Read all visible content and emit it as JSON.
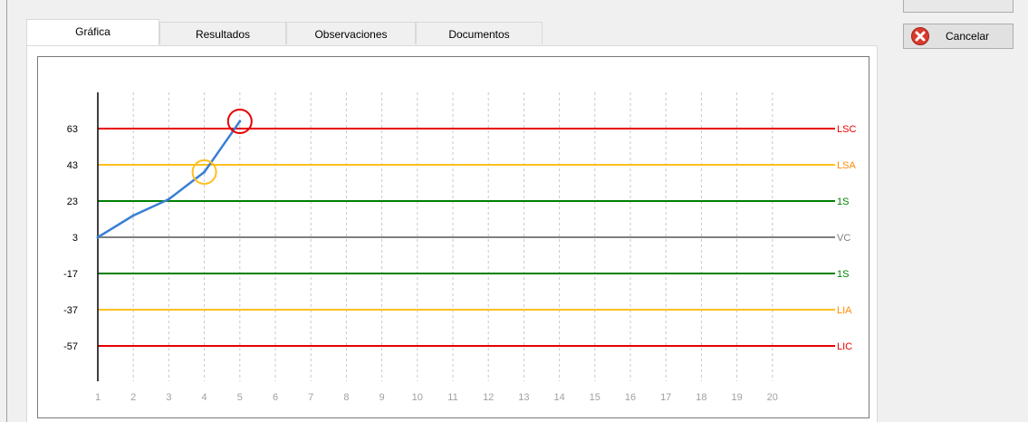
{
  "tabs": [
    {
      "label": "Gráfica",
      "active": true
    },
    {
      "label": "Resultados",
      "active": false
    },
    {
      "label": "Observaciones",
      "active": false
    },
    {
      "label": "Documentos",
      "active": false
    }
  ],
  "buttons": {
    "cancel_label": "Cancelar",
    "cancel_icon": "cancel-icon"
  },
  "colors": {
    "control_red": "#e80000",
    "alert_orange": "#ffbf1f",
    "sigma_green": "#008000",
    "center_gray": "#808080",
    "series_blue": "#3a7fd5",
    "tick_gray": "#a0a0a0",
    "lsa_label": "#ff8c00"
  },
  "chart_data": {
    "type": "line",
    "title": "",
    "xlabel": "",
    "ylabel": "",
    "x": [
      1,
      2,
      3,
      4,
      5,
      6,
      7,
      8,
      9,
      10,
      11,
      12,
      13,
      14,
      15,
      16,
      17,
      18,
      19,
      20
    ],
    "y_ticks": [
      63,
      43,
      23,
      3,
      -17,
      -37,
      -57
    ],
    "ylim": [
      -80,
      84
    ],
    "xlim": [
      0,
      20.5
    ],
    "grid": "vertical-dashed",
    "series": [
      {
        "x": [
          1,
          2,
          3,
          4,
          5
        ],
        "y": [
          3,
          15,
          24,
          39,
          67
        ]
      }
    ],
    "reference_lines": [
      {
        "label": "LSC",
        "y": 63,
        "color": "#e80000"
      },
      {
        "label": "LSA",
        "y": 43,
        "color": "#ffbf1f"
      },
      {
        "label": "1S",
        "y": 23,
        "color": "#008000"
      },
      {
        "label": "VC",
        "y": 3,
        "color": "#808080"
      },
      {
        "label": "1S",
        "y": -17,
        "color": "#008000"
      },
      {
        "label": "LIA",
        "y": -37,
        "color": "#ffbf1f"
      },
      {
        "label": "LIC",
        "y": -57,
        "color": "#e80000"
      }
    ],
    "highlights": [
      {
        "x": 4,
        "y": 39,
        "color": "#ffbf1f"
      },
      {
        "x": 5,
        "y": 67,
        "color": "#e80000"
      }
    ]
  }
}
